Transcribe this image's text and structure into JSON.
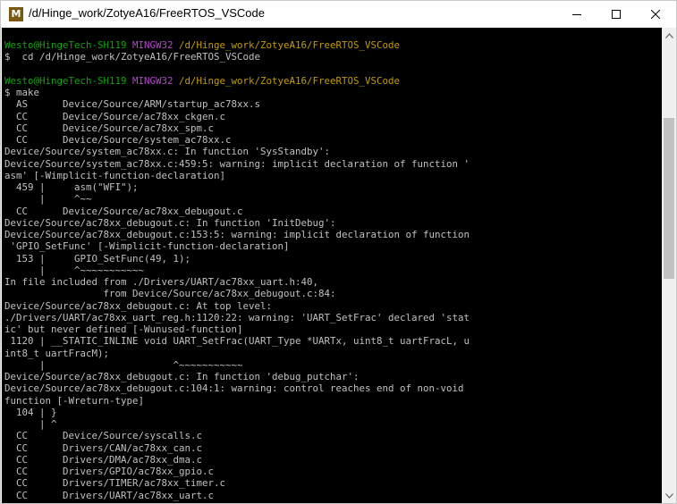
{
  "window": {
    "title": "/d/Hinge_work/ZotyeA16/FreeRTOS_VSCode",
    "app_icon": {
      "glyph": "M",
      "name": "mintty-icon"
    },
    "controls": [
      "minimize-icon",
      "maximize-icon",
      "close-icon"
    ]
  },
  "colors": {
    "background": "#000000",
    "text": "#c0c0c0",
    "prompt_user": "#13a10e",
    "prompt_system": "#b148c6",
    "prompt_path": "#c19c00"
  },
  "terminal": {
    "lines": [
      [
        {
          "t": "Westo@HingeTech-SH119 ",
          "c": "green"
        },
        {
          "t": "MINGW32 ",
          "c": "magenta"
        },
        {
          "t": "/d/Hinge_work/ZotyeA16/FreeRTOS_VSCode",
          "c": "yellow"
        }
      ],
      [
        {
          "t": "$  cd /d/Hinge_work/ZotyeA16/FreeRTOS_VSCode",
          "c": ""
        }
      ],
      [
        {
          "t": "",
          "c": ""
        }
      ],
      [
        {
          "t": "Westo@HingeTech-SH119 ",
          "c": "green"
        },
        {
          "t": "MINGW32 ",
          "c": "magenta"
        },
        {
          "t": "/d/Hinge_work/ZotyeA16/FreeRTOS_VSCode",
          "c": "yellow"
        }
      ],
      [
        {
          "t": "$ make",
          "c": ""
        }
      ],
      [
        {
          "t": "  AS      Device/Source/ARM/startup_ac78xx.s",
          "c": ""
        }
      ],
      [
        {
          "t": "  CC      Device/Source/ac78xx_ckgen.c",
          "c": ""
        }
      ],
      [
        {
          "t": "  CC      Device/Source/ac78xx_spm.c",
          "c": ""
        }
      ],
      [
        {
          "t": "  CC      Device/Source/system_ac78xx.c",
          "c": ""
        }
      ],
      [
        {
          "t": "Device/Source/system_ac78xx.c: In function 'SysStandby':",
          "c": ""
        }
      ],
      [
        {
          "t": "Device/Source/system_ac78xx.c:459:5: warning: implicit declaration of function '",
          "c": ""
        }
      ],
      [
        {
          "t": "asm' [-Wimplicit-function-declaration]",
          "c": ""
        }
      ],
      [
        {
          "t": "  459 |     asm(\"WFI\");",
          "c": ""
        }
      ],
      [
        {
          "t": "      |     ^~~",
          "c": ""
        }
      ],
      [
        {
          "t": "  CC      Device/Source/ac78xx_debugout.c",
          "c": ""
        }
      ],
      [
        {
          "t": "Device/Source/ac78xx_debugout.c: In function 'InitDebug':",
          "c": ""
        }
      ],
      [
        {
          "t": "Device/Source/ac78xx_debugout.c:153:5: warning: implicit declaration of function",
          "c": ""
        }
      ],
      [
        {
          "t": " 'GPIO_SetFunc' [-Wimplicit-function-declaration]",
          "c": ""
        }
      ],
      [
        {
          "t": "  153 |     GPIO_SetFunc(49, 1);",
          "c": ""
        }
      ],
      [
        {
          "t": "      |     ^~~~~~~~~~~~",
          "c": ""
        }
      ],
      [
        {
          "t": "In file included from ./Drivers/UART/ac78xx_uart.h:40,",
          "c": ""
        }
      ],
      [
        {
          "t": "                 from Device/Source/ac78xx_debugout.c:84:",
          "c": ""
        }
      ],
      [
        {
          "t": "Device/Source/ac78xx_debugout.c: At top level:",
          "c": ""
        }
      ],
      [
        {
          "t": "./Drivers/UART/ac78xx_uart_reg.h:1120:22: warning: 'UART_SetFrac' declared 'stat",
          "c": ""
        }
      ],
      [
        {
          "t": "ic' but never defined [-Wunused-function]",
          "c": ""
        }
      ],
      [
        {
          "t": " 1120 | __STATIC_INLINE void UART_SetFrac(UART_Type *UARTx, uint8_t uartFracL, u",
          "c": ""
        }
      ],
      [
        {
          "t": "int8_t uartFracM);",
          "c": ""
        }
      ],
      [
        {
          "t": "      |                      ^~~~~~~~~~~~",
          "c": ""
        }
      ],
      [
        {
          "t": "Device/Source/ac78xx_debugout.c: In function 'debug_putchar':",
          "c": ""
        }
      ],
      [
        {
          "t": "Device/Source/ac78xx_debugout.c:104:1: warning: control reaches end of non-void",
          "c": ""
        }
      ],
      [
        {
          "t": "function [-Wreturn-type]",
          "c": ""
        }
      ],
      [
        {
          "t": "  104 | }",
          "c": ""
        }
      ],
      [
        {
          "t": "      | ^",
          "c": ""
        }
      ],
      [
        {
          "t": "  CC      Device/Source/syscalls.c",
          "c": ""
        }
      ],
      [
        {
          "t": "  CC      Drivers/CAN/ac78xx_can.c",
          "c": ""
        }
      ],
      [
        {
          "t": "  CC      Drivers/DMA/ac78xx_dma.c",
          "c": ""
        }
      ],
      [
        {
          "t": "  CC      Drivers/GPIO/ac78xx_gpio.c",
          "c": ""
        }
      ],
      [
        {
          "t": "  CC      Drivers/TIMER/ac78xx_timer.c",
          "c": ""
        }
      ],
      [
        {
          "t": "  CC      Drivers/UART/ac78xx_uart.c",
          "c": ""
        }
      ]
    ]
  }
}
